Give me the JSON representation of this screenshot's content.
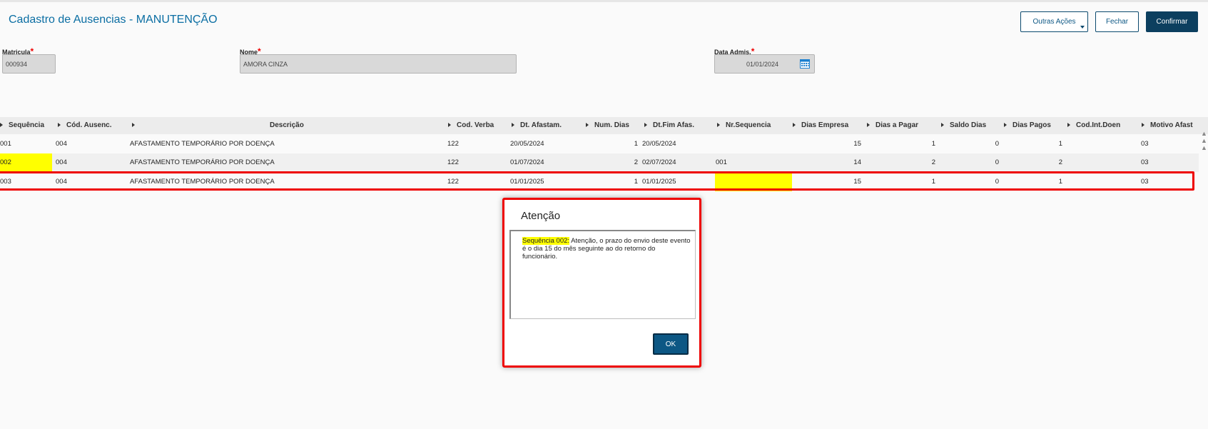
{
  "page": {
    "title": "Cadastro de Ausencias - MANUTENÇÃO"
  },
  "toolbar": {
    "outras_label": "Outras Ações",
    "fechar_label": "Fechar",
    "confirmar_label": "Confirmar"
  },
  "form": {
    "matricula": {
      "label": "Matricula",
      "value": "000934"
    },
    "nome": {
      "label": "Nome",
      "value": "AMORA CINZA"
    },
    "data_admis": {
      "label": "Data Admis.",
      "value": "01/01/2024"
    },
    "required_mark": "*"
  },
  "grid": {
    "columns": [
      "Sequência",
      "Cód. Ausenc.",
      "Descrição",
      "Cod. Verba",
      "Dt. Afastam.",
      "Num. Dias",
      "Dt.Fim Afas.",
      "Nr.Sequencia",
      "Dias Empresa",
      "Dias a Pagar",
      "Saldo Dias",
      "Dias Pagos",
      "Cod.Int.Doen",
      "Motivo Afast"
    ],
    "rows": [
      [
        "001",
        "004",
        "AFASTAMENTO TEMPORÁRIO POR DOENÇA",
        "122",
        "20/05/2024",
        "1",
        "20/05/2024",
        "",
        "15",
        "1",
        "0",
        "1",
        "",
        "03"
      ],
      [
        "002",
        "004",
        "AFASTAMENTO TEMPORÁRIO POR DOENÇA",
        "122",
        "01/07/2024",
        "2",
        "02/07/2024",
        "001",
        "14",
        "2",
        "0",
        "2",
        "",
        "03"
      ],
      [
        "003",
        "004",
        "AFASTAMENTO TEMPORÁRIO POR DOENÇA",
        "122",
        "01/01/2025",
        "1",
        "01/01/2025",
        "",
        "15",
        "1",
        "0",
        "1",
        "",
        "03"
      ]
    ]
  },
  "dialog": {
    "title": "Atenção",
    "message_prefix": "Sequência 002:",
    "message": "Atenção, o prazo do envio deste evento é o dia 15 do mês seguinte ao do retorno do funcionário.",
    "ok_label": "OK"
  },
  "colors": {
    "accent": "#0c3f5f",
    "title": "#0b6ea3",
    "highlight": "#ffff00",
    "alert_outline": "#e00000"
  },
  "icons": {
    "calendar": "calendar-icon",
    "scroll_up": "scroll-up-icon"
  }
}
